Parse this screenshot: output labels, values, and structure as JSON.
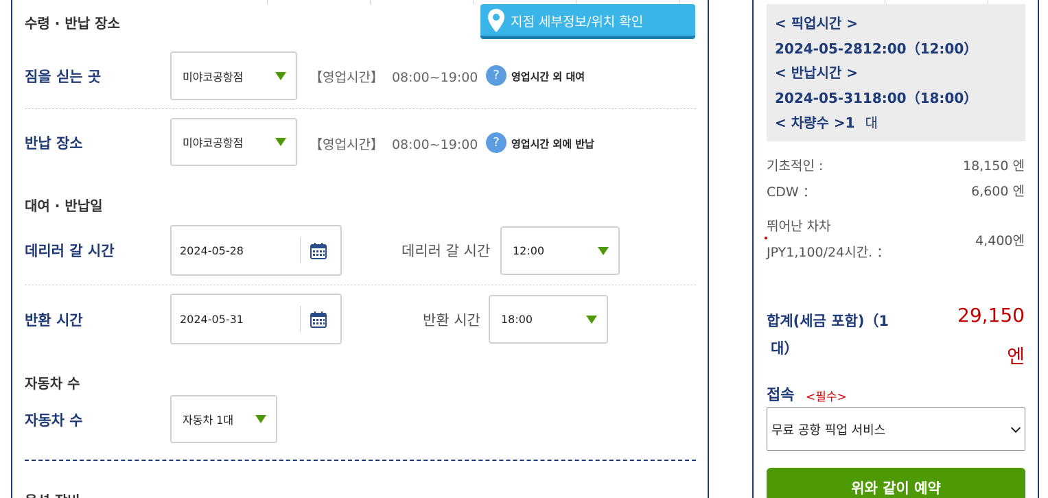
{
  "pickup_return": {
    "heading": "수령 · 반납 장소",
    "map_button": "지점 세부정보/위치 확인",
    "load_place": {
      "label": "짐을 싣는 곳",
      "value": "미야코공항점",
      "hours_label": "【영업시간】",
      "hours_value": "08:00~19:00",
      "help_text": "영업시간 외 대여"
    },
    "return_place": {
      "label": "반납 장소",
      "value": "미야코공항점",
      "hours_label": "【영업시간】",
      "hours_value": "08:00~19:00",
      "help_text": "영업시간 외에 반납"
    }
  },
  "dates": {
    "heading": "대여 · 반납일",
    "pickup": {
      "label": "데리러 갈 시간",
      "date": "2024-05-28",
      "time_caption": "데리러 갈 시간",
      "time": "12:00"
    },
    "return": {
      "label": "반환 시간",
      "date": "2024-05-31",
      "time_caption": "반환 시간",
      "time": "18:00"
    }
  },
  "cars": {
    "heading": "자동차 수",
    "label": "자동차 수",
    "value": "자동차 1대"
  },
  "options": {
    "heading": "옵션 장비"
  },
  "help_glyph": "?",
  "summary": {
    "pickup_title": "< 픽업시간 >",
    "pickup_value": "2024-05-2812:00（12:00）",
    "return_title": "< 반납시간 >",
    "return_value": "2024-05-3118:00（18:00）",
    "car_count_label": "< 차량수 >1",
    "car_count_unit": "대"
  },
  "prices": {
    "base_label": "기초적인 :",
    "base_value": "18,150 엔",
    "cdw_label": "CDW ：",
    "cdw_value": "6,600 엔",
    "extra_label_line1": "뛰어난 차차",
    "extra_label_line2": "JPY1,100/24시간. ：",
    "extra_value": "4,400엔"
  },
  "total": {
    "label_line1": "합계(세금 포함)（1",
    "label_line2": "대）",
    "amount": "29,150",
    "unit": "엔"
  },
  "connection": {
    "label": "접속",
    "required": "<필수>",
    "selected": "무료 공항 픽업 서비스"
  },
  "reserve_button": "위와 같이 예약",
  "colors": {
    "navy": "#1e3a78",
    "accent_blue": "#3bb4e8",
    "green": "#4e9a06",
    "red": "#c40000"
  }
}
